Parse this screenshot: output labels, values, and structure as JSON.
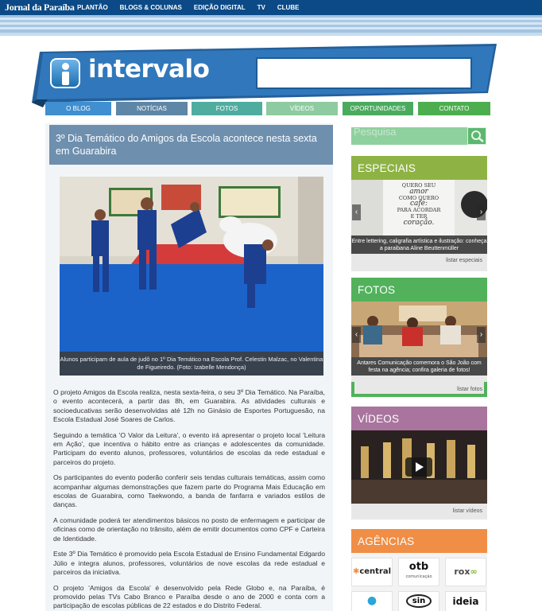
{
  "topbar": {
    "logo": "Jornal da Paraíba",
    "nav": [
      "PLANTÃO",
      "BLOGS & COLUNAS",
      "EDIÇÃO DIGITAL",
      "TV",
      "CLUBE"
    ]
  },
  "banner": {
    "brand": "intervalo"
  },
  "menu": {
    "items": [
      {
        "label": "O BLOG",
        "color": "#3f8fd1"
      },
      {
        "label": "NOTÍCIAS",
        "color": "#5e86a6"
      },
      {
        "label": "FOTOS",
        "color": "#4fada0"
      },
      {
        "label": "VÍDEOS",
        "color": "#8ecba0"
      },
      {
        "label": "OPORTUNIDADES",
        "color": "#4aab5f"
      },
      {
        "label": "CONTATO",
        "color": "#4cae4f"
      }
    ]
  },
  "article": {
    "title": "3º Dia Temático do Amigos da Escola acontece nesta sexta em Guarabira",
    "photo_caption": "Alunos participam de aula de judô no 1º Dia Temático na Escola Prof. Celestin Malzac, no Valentina de Figueiredo. (Foto: Izabelle Mendonça)",
    "paragraphs": [
      "O projeto Amigos da Escola realiza, nesta sexta-feira, o seu 3º Dia Temático. Na Paraíba, o evento acontecerá, a partir das 8h, em Guarabira. As atividades culturais e socioeducativas serão desenvolvidas até 12h no Ginásio de Esportes Portuguesão, na Escola Estadual José Soares de Carlos.",
      "Seguindo a temática 'O Valor da Leitura', o evento irá apresentar o projeto local 'Leitura em Ação', que incentiva o hábito entre as crianças e adolescentes da comunidade. Participam do evento alunos, professores, voluntários de escolas da rede estadual e parceiros do projeto.",
      "Os participantes do evento poderão conferir seis tendas culturais temáticas, assim como acompanhar algumas demonstrações que fazem parte do Programa Mais Educação em escolas de Guarabira, como Taekwondo, a banda de fanfarra e variados estilos de danças.",
      "A comunidade poderá ter atendimentos básicos no posto de enfermagem e participar de oficinas como de orientação no trânsito, além de emitir documentos como CPF e Carteira de Identidade.",
      "Este 3º Dia Temático é promovido pela Escola Estadual de Ensino Fundamental Edgardo Júlio e integra alunos, professores, voluntários de nove escolas da rede estadual e parceiros da iniciativa.",
      "O projeto 'Amigos da Escola' é desenvolvido pela Rede Globo e, na Paraíba, é promovido pelas TVs Cabo Branco e Paraíba desde o ano de 2000 e conta com a participação de escolas públicas de 22 estados e do Distrito Federal."
    ]
  },
  "sidebar": {
    "search_placeholder": "Pesquisa",
    "especiais": {
      "title": "ESPECIAIS",
      "caption": "Entre lettering, caligrafia artística e ilustração: conheça a paraibana Aline Beuttenmüller",
      "more": "listar especiais",
      "lettering": [
        "QUERO SEU",
        "amor",
        "COMO QUERO",
        "café:",
        "PARA ACORDAR",
        "E TER",
        "coração."
      ]
    },
    "fotos": {
      "title": "FOTOS",
      "caption": "Antares Comunicação comemora o São João com festa na agência; confira galeria de fotos!",
      "more": "listar fotos"
    },
    "videos": {
      "title": "VÍDEOS",
      "more": "listar vídeos"
    },
    "agencias": {
      "title": "AGÊNCIAS",
      "logos": [
        "central",
        "otb",
        "comunicação",
        "rox",
        "sin",
        "ideia"
      ]
    }
  },
  "colors": {
    "topbar": "#0b4a86",
    "banner": "#2e72b4",
    "especiais": "#8eb344",
    "fotos": "#52b25c",
    "videos": "#a9749d",
    "agencias": "#f08e46"
  }
}
